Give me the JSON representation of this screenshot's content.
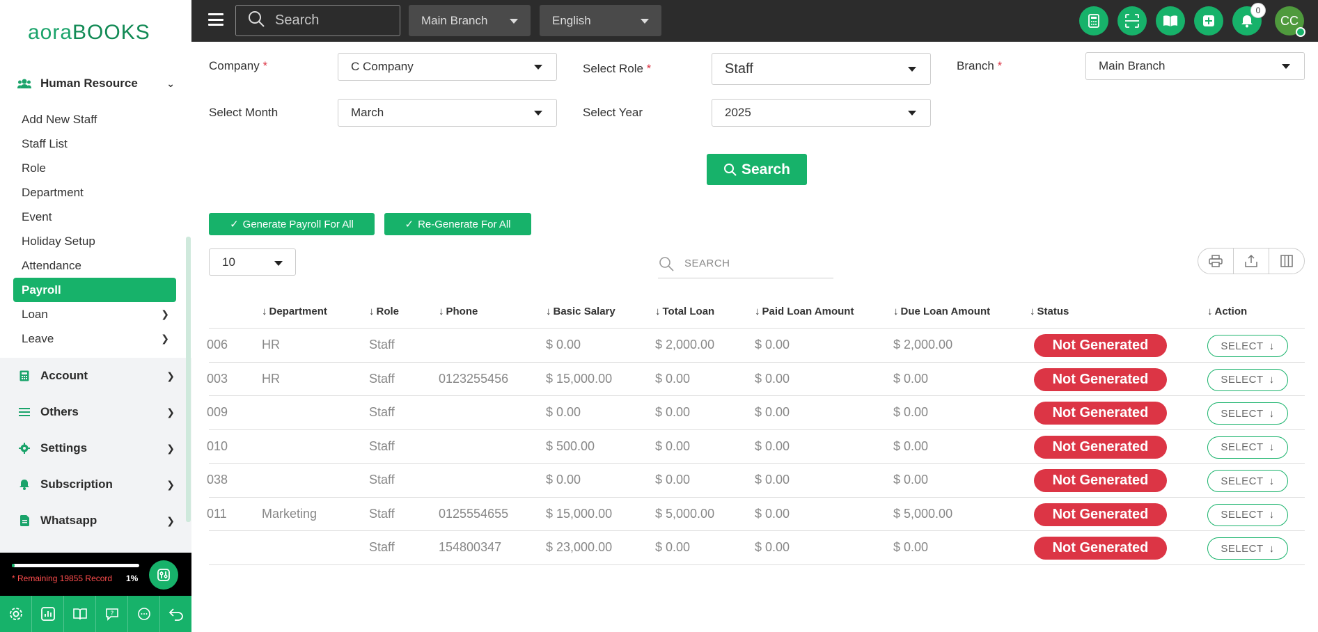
{
  "app": {
    "logo": "aoraBOOKS"
  },
  "sidebar": {
    "section_open": "Human Resource",
    "items": [
      {
        "label": "Add New Staff"
      },
      {
        "label": "Staff List"
      },
      {
        "label": "Role"
      },
      {
        "label": "Department"
      },
      {
        "label": "Event"
      },
      {
        "label": "Holiday Setup"
      },
      {
        "label": "Attendance"
      },
      {
        "label": "Payroll",
        "active": true
      },
      {
        "label": "Loan"
      },
      {
        "label": "Leave"
      }
    ],
    "sections": [
      {
        "label": "Account",
        "icon": "calculator-icon"
      },
      {
        "label": "Others",
        "icon": "list-icon"
      },
      {
        "label": "Settings",
        "icon": "gear-icon"
      },
      {
        "label": "Subscription",
        "icon": "bell-icon"
      },
      {
        "label": "Whatsapp",
        "icon": "document-icon"
      }
    ],
    "usage": {
      "text": "* Remaining 19855 Record",
      "percent_label": "1%",
      "percent": 0.01
    }
  },
  "topbar": {
    "search_placeholder": "Search",
    "branch": "Main Branch",
    "language": "English",
    "notif_count": "0",
    "avatar": "CC",
    "icons": [
      "calculator-icon",
      "scan-icon",
      "book-icon",
      "plus-icon",
      "bell-icon"
    ]
  },
  "filters": {
    "company_label": "Company",
    "company_value": "C Company",
    "role_label": "Select Role",
    "role_value": "Staff",
    "branch_label": "Branch",
    "branch_value": "Main Branch",
    "month_label": "Select Month",
    "month_value": "March",
    "year_label": "Select Year",
    "year_value": "2025",
    "search_label": "Search"
  },
  "actions": {
    "generate_all": "Generate Payroll For All",
    "regenerate_all": "Re-Generate For All"
  },
  "table": {
    "page_length": "10",
    "search_placeholder": "SEARCH",
    "columns": [
      "Department",
      "Role",
      "Phone",
      "Basic Salary",
      "Total Loan",
      "Paid Loan Amount",
      "Due Loan Amount",
      "Status",
      "Action"
    ],
    "rows": [
      {
        "id": "006",
        "department": "HR",
        "role": "Staff",
        "phone": "",
        "basic": "$ 0.00",
        "total_loan": "$ 2,000.00",
        "paid_loan": "$ 0.00",
        "due_loan": "$ 2,000.00",
        "status": "Not Generated",
        "action": "SELECT"
      },
      {
        "id": "003",
        "department": "HR",
        "role": "Staff",
        "phone": "0123255456",
        "basic": "$ 15,000.00",
        "total_loan": "$ 0.00",
        "paid_loan": "$ 0.00",
        "due_loan": "$ 0.00",
        "status": "Not Generated",
        "action": "SELECT"
      },
      {
        "id": "009",
        "department": "",
        "role": "Staff",
        "phone": "",
        "basic": "$ 0.00",
        "total_loan": "$ 0.00",
        "paid_loan": "$ 0.00",
        "due_loan": "$ 0.00",
        "status": "Not Generated",
        "action": "SELECT"
      },
      {
        "id": "010",
        "department": "",
        "role": "Staff",
        "phone": "",
        "basic": "$ 500.00",
        "total_loan": "$ 0.00",
        "paid_loan": "$ 0.00",
        "due_loan": "$ 0.00",
        "status": "Not Generated",
        "action": "SELECT"
      },
      {
        "id": "038",
        "department": "",
        "role": "Staff",
        "phone": "",
        "basic": "$ 0.00",
        "total_loan": "$ 0.00",
        "paid_loan": "$ 0.00",
        "due_loan": "$ 0.00",
        "status": "Not Generated",
        "action": "SELECT"
      },
      {
        "id": "011",
        "department": "Marketing",
        "role": "Staff",
        "phone": "0125554655",
        "basic": "$ 15,000.00",
        "total_loan": "$ 5,000.00",
        "paid_loan": "$ 0.00",
        "due_loan": "$ 5,000.00",
        "status": "Not Generated",
        "action": "SELECT"
      },
      {
        "id": "",
        "department": "",
        "role": "Staff",
        "phone": "154800347",
        "basic": "$ 23,000.00",
        "total_loan": "$ 0.00",
        "paid_loan": "$ 0.00",
        "due_loan": "$ 0.00",
        "status": "Not Generated",
        "action": "SELECT"
      }
    ]
  },
  "colors": {
    "accent": "#17b26a",
    "danger": "#dc3545",
    "topbar": "#2c2c2c"
  }
}
